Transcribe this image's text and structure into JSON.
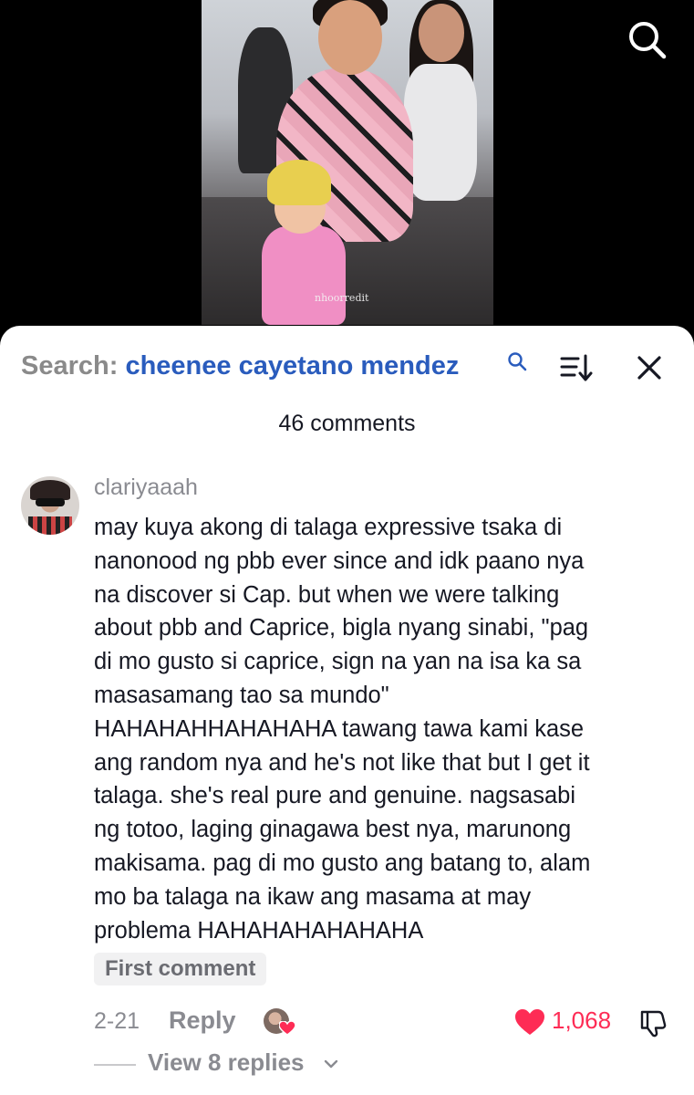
{
  "video": {
    "watermark": "nhoorredit"
  },
  "header": {
    "search_prefix": "Search:",
    "search_query": "cheenee cayetano mendez",
    "comment_count": "46 comments"
  },
  "comment": {
    "username": "clariyaaah",
    "text": "may kuya akong di talaga expressive tsaka di\nnanonood ng pbb ever since and idk paano nya\nna discover si Cap. but when we were talking\nabout pbb and Caprice, bigla nyang sinabi, \"pag\ndi mo gusto si caprice, sign na yan na isa ka sa\nmasasamang tao sa mundo\"\nHAHAHAHHAHAHAHA tawang tawa kami kase\nang random nya and he's not like that but I get it\ntalaga. she's real pure and genuine. nagsasabi\nng totoo, laging ginagawa best nya, marunong\nmakisama. pag di mo gusto ang batang to, alam\nmo ba talaga na ikaw ang masama at may\nproblema HAHAHAHAHAHAHA",
    "badge": "First comment",
    "date": "2-21",
    "reply_label": "Reply",
    "like_count": "1,068",
    "view_replies": "View 8 replies"
  },
  "icons": {
    "top": "search-icon",
    "header": [
      "search-icon",
      "sort-icon",
      "close-icon"
    ],
    "actions": [
      "heart-icon",
      "dislike-icon",
      "chevron-down-icon"
    ]
  },
  "colors": {
    "query": "#2a5cbd",
    "like": "#fe2c55",
    "muted": "#8a8b91"
  }
}
